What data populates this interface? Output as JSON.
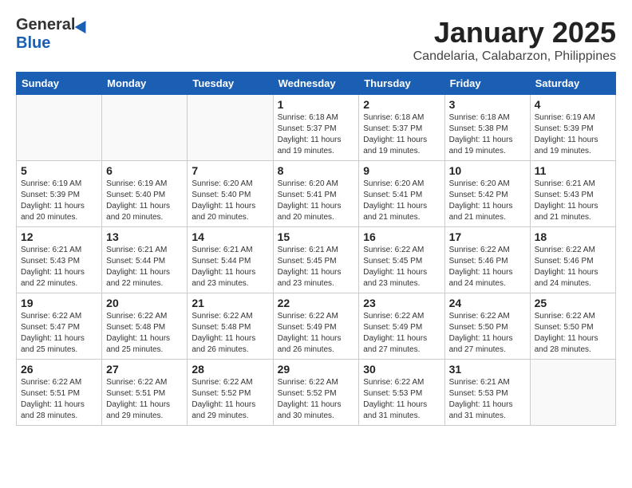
{
  "logo": {
    "general": "General",
    "blue": "Blue"
  },
  "title": "January 2025",
  "location": "Candelaria, Calabarzon, Philippines",
  "weekdays": [
    "Sunday",
    "Monday",
    "Tuesday",
    "Wednesday",
    "Thursday",
    "Friday",
    "Saturday"
  ],
  "weeks": [
    [
      {
        "day": "",
        "info": ""
      },
      {
        "day": "",
        "info": ""
      },
      {
        "day": "",
        "info": ""
      },
      {
        "day": "1",
        "info": "Sunrise: 6:18 AM\nSunset: 5:37 PM\nDaylight: 11 hours and 19 minutes."
      },
      {
        "day": "2",
        "info": "Sunrise: 6:18 AM\nSunset: 5:37 PM\nDaylight: 11 hours and 19 minutes."
      },
      {
        "day": "3",
        "info": "Sunrise: 6:18 AM\nSunset: 5:38 PM\nDaylight: 11 hours and 19 minutes."
      },
      {
        "day": "4",
        "info": "Sunrise: 6:19 AM\nSunset: 5:39 PM\nDaylight: 11 hours and 19 minutes."
      }
    ],
    [
      {
        "day": "5",
        "info": "Sunrise: 6:19 AM\nSunset: 5:39 PM\nDaylight: 11 hours and 20 minutes."
      },
      {
        "day": "6",
        "info": "Sunrise: 6:19 AM\nSunset: 5:40 PM\nDaylight: 11 hours and 20 minutes."
      },
      {
        "day": "7",
        "info": "Sunrise: 6:20 AM\nSunset: 5:40 PM\nDaylight: 11 hours and 20 minutes."
      },
      {
        "day": "8",
        "info": "Sunrise: 6:20 AM\nSunset: 5:41 PM\nDaylight: 11 hours and 20 minutes."
      },
      {
        "day": "9",
        "info": "Sunrise: 6:20 AM\nSunset: 5:41 PM\nDaylight: 11 hours and 21 minutes."
      },
      {
        "day": "10",
        "info": "Sunrise: 6:20 AM\nSunset: 5:42 PM\nDaylight: 11 hours and 21 minutes."
      },
      {
        "day": "11",
        "info": "Sunrise: 6:21 AM\nSunset: 5:43 PM\nDaylight: 11 hours and 21 minutes."
      }
    ],
    [
      {
        "day": "12",
        "info": "Sunrise: 6:21 AM\nSunset: 5:43 PM\nDaylight: 11 hours and 22 minutes."
      },
      {
        "day": "13",
        "info": "Sunrise: 6:21 AM\nSunset: 5:44 PM\nDaylight: 11 hours and 22 minutes."
      },
      {
        "day": "14",
        "info": "Sunrise: 6:21 AM\nSunset: 5:44 PM\nDaylight: 11 hours and 23 minutes."
      },
      {
        "day": "15",
        "info": "Sunrise: 6:21 AM\nSunset: 5:45 PM\nDaylight: 11 hours and 23 minutes."
      },
      {
        "day": "16",
        "info": "Sunrise: 6:22 AM\nSunset: 5:45 PM\nDaylight: 11 hours and 23 minutes."
      },
      {
        "day": "17",
        "info": "Sunrise: 6:22 AM\nSunset: 5:46 PM\nDaylight: 11 hours and 24 minutes."
      },
      {
        "day": "18",
        "info": "Sunrise: 6:22 AM\nSunset: 5:46 PM\nDaylight: 11 hours and 24 minutes."
      }
    ],
    [
      {
        "day": "19",
        "info": "Sunrise: 6:22 AM\nSunset: 5:47 PM\nDaylight: 11 hours and 25 minutes."
      },
      {
        "day": "20",
        "info": "Sunrise: 6:22 AM\nSunset: 5:48 PM\nDaylight: 11 hours and 25 minutes."
      },
      {
        "day": "21",
        "info": "Sunrise: 6:22 AM\nSunset: 5:48 PM\nDaylight: 11 hours and 26 minutes."
      },
      {
        "day": "22",
        "info": "Sunrise: 6:22 AM\nSunset: 5:49 PM\nDaylight: 11 hours and 26 minutes."
      },
      {
        "day": "23",
        "info": "Sunrise: 6:22 AM\nSunset: 5:49 PM\nDaylight: 11 hours and 27 minutes."
      },
      {
        "day": "24",
        "info": "Sunrise: 6:22 AM\nSunset: 5:50 PM\nDaylight: 11 hours and 27 minutes."
      },
      {
        "day": "25",
        "info": "Sunrise: 6:22 AM\nSunset: 5:50 PM\nDaylight: 11 hours and 28 minutes."
      }
    ],
    [
      {
        "day": "26",
        "info": "Sunrise: 6:22 AM\nSunset: 5:51 PM\nDaylight: 11 hours and 28 minutes."
      },
      {
        "day": "27",
        "info": "Sunrise: 6:22 AM\nSunset: 5:51 PM\nDaylight: 11 hours and 29 minutes."
      },
      {
        "day": "28",
        "info": "Sunrise: 6:22 AM\nSunset: 5:52 PM\nDaylight: 11 hours and 29 minutes."
      },
      {
        "day": "29",
        "info": "Sunrise: 6:22 AM\nSunset: 5:52 PM\nDaylight: 11 hours and 30 minutes."
      },
      {
        "day": "30",
        "info": "Sunrise: 6:22 AM\nSunset: 5:53 PM\nDaylight: 11 hours and 31 minutes."
      },
      {
        "day": "31",
        "info": "Sunrise: 6:21 AM\nSunset: 5:53 PM\nDaylight: 11 hours and 31 minutes."
      },
      {
        "day": "",
        "info": ""
      }
    ]
  ]
}
